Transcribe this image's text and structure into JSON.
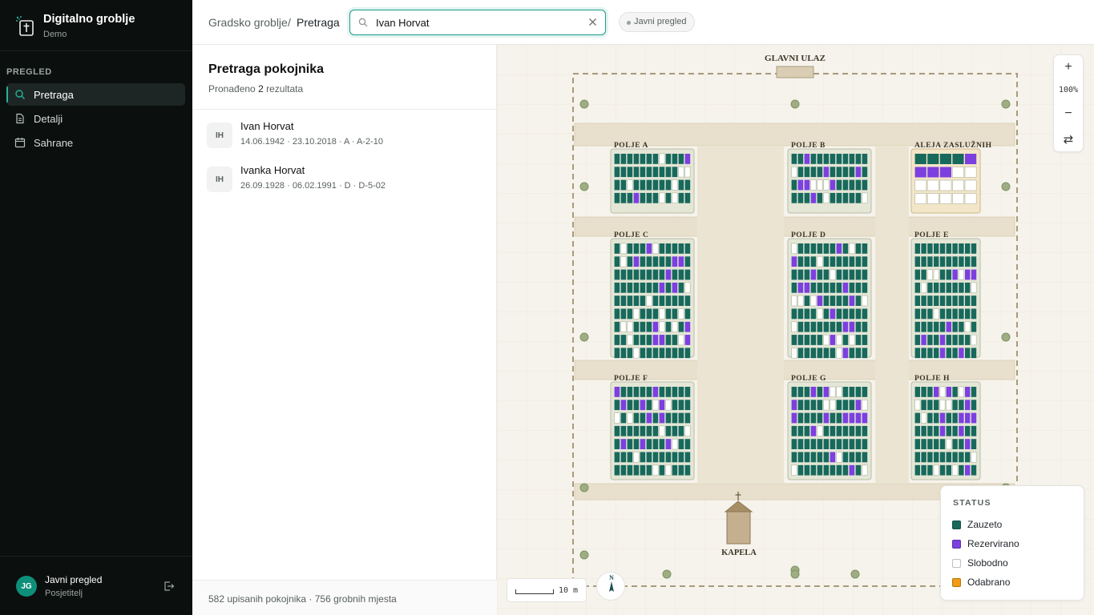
{
  "app": {
    "title": "Digitalno groblje",
    "subtitle": "Demo"
  },
  "nav": {
    "section": "PREGLED",
    "items": [
      {
        "label": "Pretraga",
        "icon": "search-icon",
        "active": true
      },
      {
        "label": "Detalji",
        "icon": "document-icon",
        "active": false
      },
      {
        "label": "Sahrane",
        "icon": "calendar-icon",
        "active": false
      }
    ]
  },
  "user": {
    "initials": "JG",
    "name": "Javni pregled",
    "role": "Posjetitelj"
  },
  "breadcrumb": {
    "root": "Gradsko groblje",
    "separator": "/",
    "current": "Pretraga"
  },
  "search": {
    "value": "Ivan Horvat",
    "placeholder": ""
  },
  "mode_badge": "Javni pregled",
  "results": {
    "title": "Pretraga pokojnika",
    "sub_prefix": "Pronađeno",
    "count": "2",
    "sub_suffix": "rezultata",
    "items": [
      {
        "initials": "IH",
        "name": "Ivan Horvat",
        "meta": "14.06.1942 · 23.10.2018 · A · A-2-10"
      },
      {
        "initials": "IH",
        "name": "Ivanka Horvat",
        "meta": "26.09.1928 · 06.02.1991 · D · D-5-02"
      }
    ],
    "footer": "582 upisanih pokojnika · 756 grobnih mjesta"
  },
  "map": {
    "entrance_label": "GLAVNI ULAZ",
    "chapel_label": "KAPELA",
    "fields": [
      "POLJE A",
      "POLJE B",
      "ALEJA ZASLUŽNIH",
      "POLJE C",
      "POLJE D",
      "POLJE E",
      "POLJE F",
      "POLJE G",
      "POLJE H"
    ],
    "zoom": {
      "plus": "+",
      "level": "100%",
      "minus": "−",
      "swap": "⇄"
    },
    "scale_label": "10 m",
    "compass_label": "N",
    "legend": {
      "title": "STATUS",
      "items": [
        {
          "label": "Zauzeto",
          "color": "#17695c"
        },
        {
          "label": "Rezervirano",
          "color": "#7c3fe0"
        },
        {
          "label": "Slobodno",
          "color": "#ffffff"
        },
        {
          "label": "Odabrano",
          "color": "#f29a12"
        }
      ]
    }
  },
  "colors": {
    "accent": "#1a9d88",
    "occupied": "#17695c",
    "reserved": "#7c3fe0",
    "free": "#ffffff",
    "selected": "#f29a12"
  }
}
